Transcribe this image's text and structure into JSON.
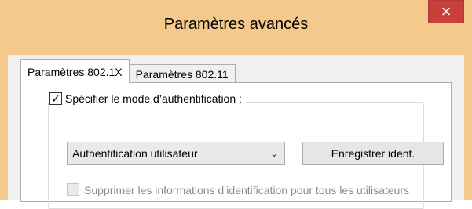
{
  "window": {
    "title": "Paramètres avancés",
    "close_label": "×"
  },
  "tabs": [
    {
      "label": "Paramètres 802.1X",
      "active": true
    },
    {
      "label": "Paramètres 802.11",
      "active": false
    }
  ],
  "auth_section": {
    "specify_mode_label": "Spécifier le mode d’authentification :",
    "specify_mode_checked": true,
    "mode_selected": "Authentification utilisateur",
    "save_credentials_button": "Enregistrer ident.",
    "delete_credentials_label": "Supprimer les informations d’identification pour tous les utilisateurs",
    "delete_credentials_checked": false,
    "delete_credentials_enabled": false
  },
  "colors": {
    "title_bar": "#f5c98c",
    "close_button": "#c9403a"
  },
  "icons": {
    "close": "close-icon",
    "dropdown": "chevron-down-icon",
    "check": "checkmark-icon"
  }
}
